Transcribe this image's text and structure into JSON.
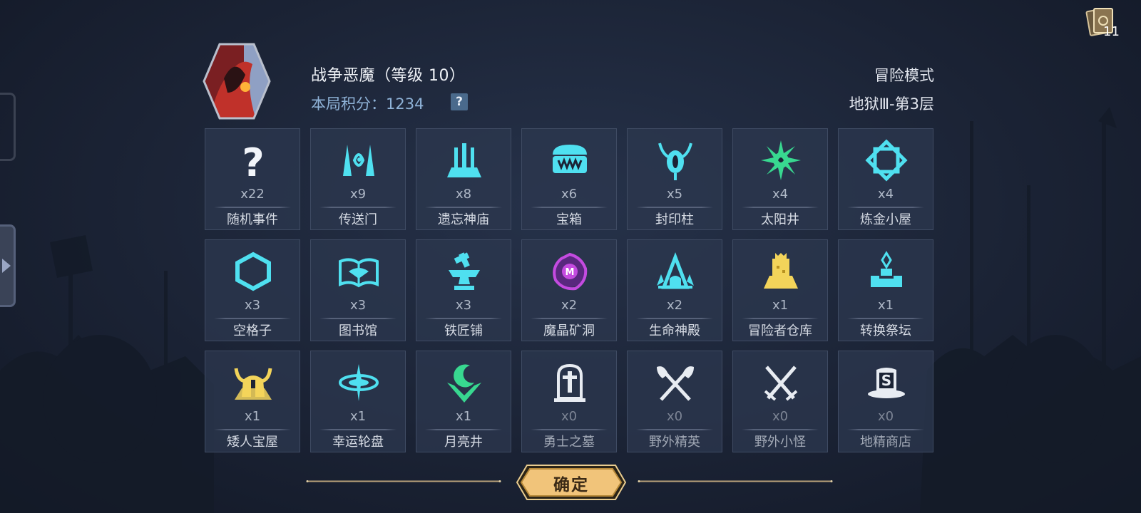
{
  "hud": {
    "deck_count": "11"
  },
  "header": {
    "boss_name": "战争恶魔（等级 10）",
    "score_label": "本局积分：",
    "score_value": "1234",
    "help_glyph": "?",
    "mode": "冒险模式",
    "floor": "地狱Ⅲ-第3层"
  },
  "colors": {
    "cyan": "#4fe0f0",
    "green": "#38d890",
    "gold": "#f3d45a",
    "purple": "#c44be0",
    "white": "#e8ecf2",
    "button_gold": "#f1c47a"
  },
  "events": [
    {
      "name": "随机事件",
      "count": "x22",
      "icon": "question-icon"
    },
    {
      "name": "传送门",
      "count": "x9",
      "icon": "portal-icon"
    },
    {
      "name": "遗忘神庙",
      "count": "x8",
      "icon": "temple-icon"
    },
    {
      "name": "宝箱",
      "count": "x6",
      "icon": "treasure-chest-icon"
    },
    {
      "name": "封印柱",
      "count": "x5",
      "icon": "seal-pillar-icon"
    },
    {
      "name": "太阳井",
      "count": "x4",
      "icon": "sun-well-icon"
    },
    {
      "name": "炼金小屋",
      "count": "x4",
      "icon": "alchemy-hut-icon"
    },
    {
      "name": "空格子",
      "count": "x3",
      "icon": "hexagon-icon"
    },
    {
      "name": "图书馆",
      "count": "x3",
      "icon": "library-book-icon"
    },
    {
      "name": "铁匠铺",
      "count": "x3",
      "icon": "anvil-icon"
    },
    {
      "name": "魔晶矿洞",
      "count": "x2",
      "icon": "magic-crystal-mine-icon"
    },
    {
      "name": "生命神殿",
      "count": "x2",
      "icon": "life-shrine-icon"
    },
    {
      "name": "冒险者仓库",
      "count": "x1",
      "icon": "warehouse-icon"
    },
    {
      "name": "转换祭坛",
      "count": "x1",
      "icon": "altar-icon"
    },
    {
      "name": "矮人宝屋",
      "count": "x1",
      "icon": "dwarf-helmet-icon"
    },
    {
      "name": "幸运轮盘",
      "count": "x1",
      "icon": "lucky-wheel-icon"
    },
    {
      "name": "月亮井",
      "count": "x1",
      "icon": "moon-well-icon"
    },
    {
      "name": "勇士之墓",
      "count": "x0",
      "icon": "tombstone-icon"
    },
    {
      "name": "野外精英",
      "count": "x0",
      "icon": "crossed-axes-icon"
    },
    {
      "name": "野外小怪",
      "count": "x0",
      "icon": "crossed-swords-icon"
    },
    {
      "name": "地精商店",
      "count": "x0",
      "icon": "goblin-shop-icon"
    }
  ],
  "footer": {
    "confirm_label": "确定"
  }
}
